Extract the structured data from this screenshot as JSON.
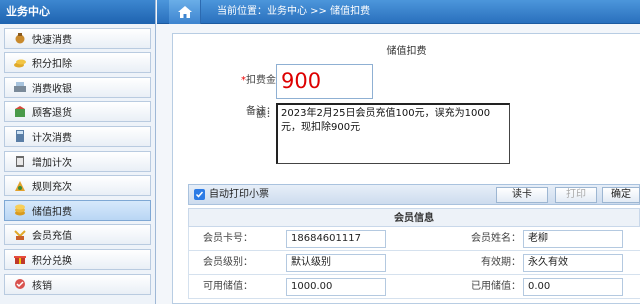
{
  "sidebar": {
    "title": "业务中心",
    "items": [
      {
        "label": "快速消费",
        "icon": "money-bag-icon"
      },
      {
        "label": "积分扣除",
        "icon": "coins-icon"
      },
      {
        "label": "消费收银",
        "icon": "cash-register-icon"
      },
      {
        "label": "顾客退货",
        "icon": "return-goods-icon"
      },
      {
        "label": "计次消费",
        "icon": "calculator-icon"
      },
      {
        "label": "增加计次",
        "icon": "clipboard-icon"
      },
      {
        "label": "规则充次",
        "icon": "rule-icon"
      },
      {
        "label": "储值扣费",
        "icon": "coin-stack-icon",
        "active": true
      },
      {
        "label": "会员充值",
        "icon": "recharge-icon"
      },
      {
        "label": "积分兑换",
        "icon": "gift-icon"
      },
      {
        "label": "核销",
        "icon": "verify-icon"
      }
    ]
  },
  "topbar": {
    "breadcrumb": "当前位置：业务中心 >> 储值扣费"
  },
  "form": {
    "title": "储值扣费",
    "amount_label_req": "*",
    "amount_label": "扣费金额：",
    "amount_value": "900",
    "memo_label": "备注：",
    "memo_value": "2023年2月25日会员充值100元，误充为1000元，现扣除900元"
  },
  "actions": {
    "auto_print_label": "自动打印小票",
    "auto_print_checked": true,
    "read_card": "读卡",
    "print": "打印",
    "confirm": "确定"
  },
  "member": {
    "title": "会员信息",
    "card_no_label": "会员卡号：",
    "card_no": "18684601117",
    "name_label": "会员姓名：",
    "name": "老柳",
    "level_label": "会员级别：",
    "level": "默认级别",
    "validity_label": "有效期：",
    "validity": "永久有效",
    "balance_label": "可用储值：",
    "balance": "1000.00",
    "used_label": "已用储值：",
    "used": "0.00"
  },
  "colors": {
    "accent": "#2a70bd",
    "amount": "#dd0000",
    "required": "#ee0000"
  }
}
